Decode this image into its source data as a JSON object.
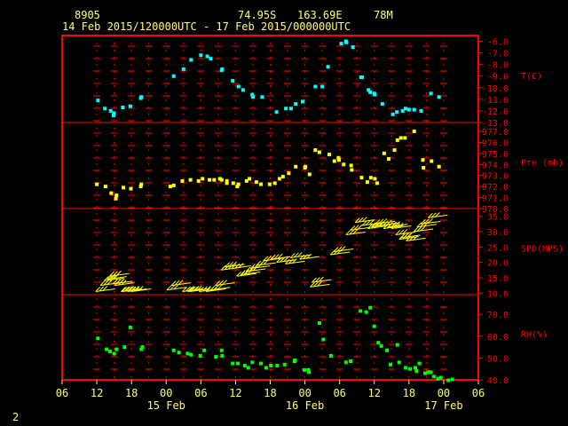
{
  "header": {
    "station": "8905",
    "lat": "74.95S",
    "lon": "163.69E",
    "elev": "78M",
    "period": "14 Feb 2015/120000UTC - 17 Feb 2015/000000UTC"
  },
  "page_number": "2",
  "colors": {
    "frame": "#ff0000",
    "label": "#ffff66",
    "temperature": "#00ffff",
    "pressure": "#ffff00",
    "wind": "#ffff00",
    "rh": "#00ff00"
  },
  "chart_data": {
    "type": "scatter",
    "x_unit": "hours since 14 Feb 2015 00 UTC",
    "x_range": [
      6,
      78
    ],
    "x_ticks": [
      {
        "h": 6,
        "label": "06"
      },
      {
        "h": 12,
        "label": "12"
      },
      {
        "h": 18,
        "label": "18"
      },
      {
        "h": 24,
        "label": "00"
      },
      {
        "h": 30,
        "label": "06"
      },
      {
        "h": 36,
        "label": "12"
      },
      {
        "h": 42,
        "label": "18"
      },
      {
        "h": 48,
        "label": "00"
      },
      {
        "h": 54,
        "label": "06"
      },
      {
        "h": 60,
        "label": "12"
      },
      {
        "h": 66,
        "label": "18"
      },
      {
        "h": 72,
        "label": "00"
      },
      {
        "h": 78,
        "label": "06"
      }
    ],
    "date_labels": [
      {
        "h": 24,
        "label": "15 Feb"
      },
      {
        "h": 48,
        "label": "16 Feb"
      },
      {
        "h": 72,
        "label": "17 Feb"
      }
    ],
    "panels": [
      {
        "name": "T(C)",
        "kind": "points",
        "color": "#00ffff",
        "range": [
          -13,
          -5.5
        ],
        "ticks": [
          -6,
          -7,
          -8,
          -9,
          -10,
          -11,
          -12,
          -13
        ],
        "tick_labels": [
          "-6.0",
          "-7.0",
          "-8.0",
          "-9.0",
          "-10.0",
          "-11.0",
          "-12.0",
          "-13.0"
        ],
        "points": [
          [
            12.2,
            -11.1
          ],
          [
            13.4,
            -11.8
          ],
          [
            14.4,
            -12.0
          ],
          [
            14.9,
            -12.4
          ],
          [
            15.0,
            -12.2
          ],
          [
            16.5,
            -11.7
          ],
          [
            17.8,
            -11.6
          ],
          [
            19.6,
            -10.9
          ],
          [
            19.7,
            -10.8
          ],
          [
            25.3,
            -9.0
          ],
          [
            27.0,
            -8.4
          ],
          [
            28.3,
            -7.6
          ],
          [
            30.0,
            -7.2
          ],
          [
            31.1,
            -7.3
          ],
          [
            31.7,
            -7.5
          ],
          [
            33.6,
            -8.5
          ],
          [
            33.7,
            -8.4
          ],
          [
            35.5,
            -9.4
          ],
          [
            36.5,
            -9.9
          ],
          [
            37.3,
            -10.2
          ],
          [
            38.9,
            -10.6
          ],
          [
            39.0,
            -10.8
          ],
          [
            40.6,
            -10.8
          ],
          [
            43.1,
            -12.1
          ],
          [
            44.7,
            -11.8
          ],
          [
            45.6,
            -11.8
          ],
          [
            46.4,
            -11.4
          ],
          [
            47.6,
            -11.2
          ],
          [
            49.8,
            -9.9
          ],
          [
            51.0,
            -9.9
          ],
          [
            52.0,
            -8.2
          ],
          [
            54.3,
            -6.2
          ],
          [
            55.1,
            -6.0
          ],
          [
            55.2,
            -6.1
          ],
          [
            56.3,
            -6.5
          ],
          [
            57.7,
            -9.1
          ],
          [
            57.9,
            -9.1
          ],
          [
            59.0,
            -10.2
          ],
          [
            59.3,
            -10.4
          ],
          [
            60.0,
            -10.5
          ],
          [
            60.1,
            -10.6
          ],
          [
            61.4,
            -11.4
          ],
          [
            63.2,
            -12.3
          ],
          [
            63.9,
            -12.1
          ],
          [
            64.9,
            -12.0
          ],
          [
            65.4,
            -11.8
          ],
          [
            66.0,
            -11.9
          ],
          [
            66.9,
            -11.9
          ],
          [
            68.1,
            -12.0
          ],
          [
            69.8,
            -10.5
          ],
          [
            71.2,
            -10.8
          ]
        ]
      },
      {
        "name": "Pre (mb)",
        "kind": "points",
        "color": "#ffff00",
        "range": [
          970,
          977.8
        ],
        "ticks": [
          970,
          971,
          972,
          973,
          974,
          975,
          976,
          977
        ],
        "tick_labels": [
          "970.0",
          "971.0",
          "972.0",
          "973.0",
          "974.0",
          "975.0",
          "976.0",
          "977.0"
        ],
        "points": [
          [
            12.0,
            972.2
          ],
          [
            13.5,
            972.0
          ],
          [
            14.5,
            971.4
          ],
          [
            15.3,
            970.9
          ],
          [
            15.4,
            971.2
          ],
          [
            16.6,
            971.9
          ],
          [
            17.9,
            971.8
          ],
          [
            19.6,
            972.0
          ],
          [
            19.7,
            972.2
          ],
          [
            24.7,
            972.0
          ],
          [
            25.3,
            972.1
          ],
          [
            26.8,
            972.5
          ],
          [
            28.2,
            972.6
          ],
          [
            29.6,
            972.5
          ],
          [
            30.3,
            972.7
          ],
          [
            31.5,
            972.6
          ],
          [
            32.3,
            972.6
          ],
          [
            33.3,
            972.7
          ],
          [
            33.6,
            972.6
          ],
          [
            34.5,
            972.5
          ],
          [
            34.5,
            972.3
          ],
          [
            35.6,
            972.3
          ],
          [
            36.3,
            972.0
          ],
          [
            36.5,
            972.2
          ],
          [
            37.9,
            972.5
          ],
          [
            38.4,
            972.7
          ],
          [
            39.6,
            972.4
          ],
          [
            40.4,
            972.2
          ],
          [
            41.9,
            972.2
          ],
          [
            42.8,
            972.3
          ],
          [
            43.6,
            972.7
          ],
          [
            44.2,
            972.9
          ],
          [
            45.2,
            973.2
          ],
          [
            46.4,
            973.8
          ],
          [
            48.0,
            973.7
          ],
          [
            48.1,
            973.8
          ],
          [
            48.8,
            973.1
          ],
          [
            49.8,
            975.3
          ],
          [
            50.5,
            975.1
          ],
          [
            52.2,
            974.9
          ],
          [
            53.1,
            974.3
          ],
          [
            53.8,
            974.6
          ],
          [
            53.9,
            974.4
          ],
          [
            54.7,
            974.0
          ],
          [
            56.0,
            973.9
          ],
          [
            56.1,
            973.5
          ],
          [
            57.8,
            972.8
          ],
          [
            58.8,
            972.4
          ],
          [
            59.4,
            972.8
          ],
          [
            60.1,
            972.7
          ],
          [
            60.5,
            972.3
          ],
          [
            61.7,
            975.0
          ],
          [
            62.5,
            974.5
          ],
          [
            63.5,
            975.3
          ],
          [
            64.0,
            976.2
          ],
          [
            64.6,
            976.4
          ],
          [
            65.3,
            976.4
          ],
          [
            66.9,
            977.0
          ],
          [
            68.4,
            974.4
          ],
          [
            68.5,
            973.7
          ],
          [
            69.9,
            974.3
          ],
          [
            71.2,
            973.8
          ]
        ]
      },
      {
        "name": "SPD(MPS)",
        "kind": "wind",
        "color": "#ffff00",
        "range": [
          9.5,
          37.5
        ],
        "ticks": [
          10,
          15,
          20,
          25,
          30,
          35
        ],
        "tick_labels": [
          "10.0",
          "15.0",
          "20.0",
          "25.0",
          "30.0",
          "35.0"
        ],
        "points": [
          [
            11.8,
            10.5
          ],
          [
            12.6,
            12.5
          ],
          [
            13.3,
            14.0
          ],
          [
            13.8,
            14.5
          ],
          [
            14.2,
            15.5
          ],
          [
            14.8,
            13.0
          ],
          [
            15.1,
            12.5
          ],
          [
            16.2,
            10.5
          ],
          [
            16.4,
            10.5
          ],
          [
            17.3,
            10.5
          ],
          [
            18.0,
            10.5
          ],
          [
            24.1,
            11.0
          ],
          [
            24.9,
            12.5
          ],
          [
            26.8,
            10.5
          ],
          [
            27.7,
            10.5
          ],
          [
            28.1,
            10.5
          ],
          [
            29.7,
            10.5
          ],
          [
            30.9,
            10.5
          ],
          [
            31.7,
            11.0
          ],
          [
            32.5,
            12.5
          ],
          [
            33.5,
            17.5
          ],
          [
            34.2,
            18.5
          ],
          [
            35.3,
            18.0
          ],
          [
            36.2,
            15.5
          ],
          [
            36.9,
            16.0
          ],
          [
            37.8,
            17.0
          ],
          [
            38.6,
            18.0
          ],
          [
            39.6,
            19.0
          ],
          [
            40.8,
            20.5
          ],
          [
            42.1,
            21.0
          ],
          [
            43.1,
            20.0
          ],
          [
            44.6,
            19.5
          ],
          [
            45.5,
            21.5
          ],
          [
            47.1,
            21.0
          ],
          [
            48.9,
            12.0
          ],
          [
            49.2,
            13.5
          ],
          [
            52.4,
            22.5
          ],
          [
            53.0,
            23.5
          ],
          [
            55.1,
            29.0
          ],
          [
            55.9,
            30.5
          ],
          [
            56.7,
            33.0
          ],
          [
            57.9,
            32.0
          ],
          [
            58.9,
            31.0
          ],
          [
            59.5,
            31.5
          ],
          [
            60.2,
            32.5
          ],
          [
            61.0,
            32.0
          ],
          [
            61.6,
            31.0
          ],
          [
            62.4,
            31.5
          ],
          [
            63.0,
            31.0
          ],
          [
            63.7,
            29.0
          ],
          [
            64.3,
            27.5
          ],
          [
            64.6,
            28.0
          ],
          [
            65.5,
            27.0
          ],
          [
            66.8,
            30.0
          ],
          [
            67.4,
            31.5
          ],
          [
            68.1,
            32.5
          ],
          [
            69.3,
            34.5
          ]
        ]
      },
      {
        "name": "RH(%)",
        "kind": "points",
        "color": "#00ff00",
        "range": [
          40,
          79
        ],
        "ticks": [
          40,
          50,
          60,
          70
        ],
        "tick_labels": [
          "40.0",
          "50.0",
          "60.0",
          "70.0"
        ],
        "points": [
          [
            12.2,
            59.0
          ],
          [
            13.7,
            54.0
          ],
          [
            14.3,
            53.0
          ],
          [
            15.0,
            52.0
          ],
          [
            15.4,
            54.0
          ],
          [
            16.8,
            55.0
          ],
          [
            17.8,
            64.0
          ],
          [
            19.7,
            54.0
          ],
          [
            19.9,
            55.0
          ],
          [
            25.3,
            53.5
          ],
          [
            26.2,
            52.5
          ],
          [
            27.7,
            52.0
          ],
          [
            28.3,
            51.5
          ],
          [
            29.9,
            51.0
          ],
          [
            30.6,
            53.5
          ],
          [
            32.6,
            50.5
          ],
          [
            33.6,
            53.5
          ],
          [
            33.7,
            51.0
          ],
          [
            35.5,
            47.5
          ],
          [
            36.4,
            47.5
          ],
          [
            37.6,
            46.5
          ],
          [
            38.2,
            45.5
          ],
          [
            38.9,
            48.0
          ],
          [
            40.4,
            47.5
          ],
          [
            41.3,
            45.5
          ],
          [
            42.1,
            46.5
          ],
          [
            43.2,
            46.5
          ],
          [
            44.5,
            47.0
          ],
          [
            46.2,
            48.5
          ],
          [
            46.3,
            49.0
          ],
          [
            47.9,
            44.5
          ],
          [
            48.6,
            44.5
          ],
          [
            48.7,
            43.5
          ],
          [
            50.5,
            66.0
          ],
          [
            51.2,
            58.5
          ],
          [
            52.5,
            51.0
          ],
          [
            55.1,
            48.0
          ],
          [
            55.9,
            48.5
          ],
          [
            57.6,
            71.5
          ],
          [
            58.6,
            71.0
          ],
          [
            59.3,
            73.0
          ],
          [
            60.0,
            64.5
          ],
          [
            60.7,
            57.0
          ],
          [
            61.2,
            55.5
          ],
          [
            62.2,
            53.5
          ],
          [
            62.8,
            47.0
          ],
          [
            64.0,
            56.0
          ],
          [
            64.3,
            48.0
          ],
          [
            65.4,
            45.5
          ],
          [
            66.2,
            45.0
          ],
          [
            67.1,
            45.5
          ],
          [
            67.3,
            44.0
          ],
          [
            67.8,
            47.5
          ],
          [
            68.8,
            43.0
          ],
          [
            69.3,
            43.5
          ],
          [
            69.8,
            43.5
          ],
          [
            70.3,
            41.5
          ],
          [
            71.0,
            40.5
          ],
          [
            71.5,
            41.0
          ],
          [
            72.8,
            39.8
          ],
          [
            73.5,
            40.2
          ]
        ]
      }
    ]
  }
}
